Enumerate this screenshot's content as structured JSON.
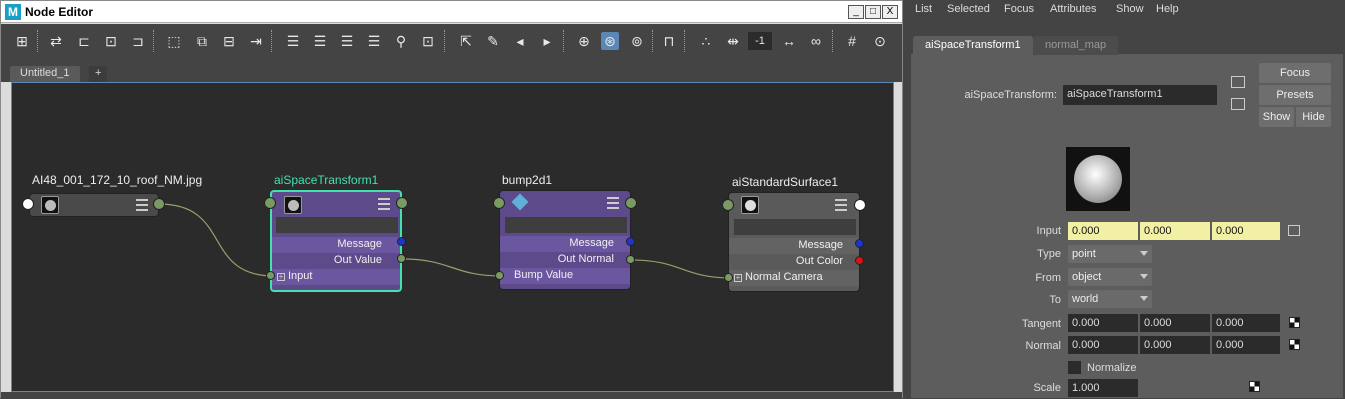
{
  "window": {
    "title": "Node Editor",
    "minimize": "_",
    "maximize": "□",
    "close": "X"
  },
  "toolbar": {
    "icons": [
      "add-node-icon",
      "swap-icon",
      "input-icon",
      "input-output-icon",
      "output-icon",
      "frame-all-icon",
      "frame-selected-icon",
      "graph-up-icon",
      "graph-down-icon",
      "layout-list1-icon",
      "layout-list2-icon",
      "layout-list3-icon",
      "layout-list4-icon",
      "search-icon",
      "snapshot-icon",
      "pin-icon",
      "edit-icon",
      "back-icon",
      "forward-icon",
      "grid-icon",
      "connect-mode-icon",
      "filter-icon",
      "lock-icon",
      "dots-icon",
      "expand-icon",
      "field-icon",
      "swap-horizontal-icon",
      "infinity-icon",
      "hash-icon",
      "magnet-icon"
    ],
    "field_value": "-1"
  },
  "tabs": [
    {
      "label": "Untitled_1"
    },
    {
      "label": "+"
    }
  ],
  "graph": {
    "nodes": {
      "file": {
        "title": "AI48_001_172_10_roof_NM.jpg"
      },
      "space": {
        "title": "aiSpaceTransform1",
        "message": "Message",
        "out": "Out Value",
        "in": "Input"
      },
      "bump": {
        "title": "bump2d1",
        "message": "Message",
        "out": "Out Normal",
        "in": "Bump Value"
      },
      "shader": {
        "title": "aiStandardSurface1",
        "message": "Message",
        "out": "Out Color",
        "in": "Normal Camera"
      }
    },
    "colors": {
      "canvas": "#2b2b2b",
      "file_node": "#4a4a4a",
      "purple_node": "#5c4a8a",
      "shader_node": "#5a5a5a",
      "selected_border": "#43e0b0",
      "wire": "#9a9e6c"
    }
  },
  "attr_editor": {
    "menu": [
      "List",
      "Selected",
      "Focus",
      "Attributes",
      "Show",
      "Help"
    ],
    "tabs": [
      {
        "label": "aiSpaceTransform1",
        "active": true
      },
      {
        "label": "normal_map",
        "active": false
      }
    ],
    "node_label": "aiSpaceTransform:",
    "node_value": "aiSpaceTransform1",
    "buttons": {
      "focus": "Focus",
      "presets": "Presets",
      "show": "Show",
      "hide": "Hide"
    },
    "input": {
      "label": "Input",
      "values": [
        "0.000",
        "0.000",
        "0.000"
      ]
    },
    "type": {
      "label": "Type",
      "value": "point"
    },
    "from": {
      "label": "From",
      "value": "object"
    },
    "to": {
      "label": "To",
      "value": "world"
    },
    "tangent": {
      "label": "Tangent",
      "values": [
        "0.000",
        "0.000",
        "0.000"
      ]
    },
    "normal": {
      "label": "Normal",
      "values": [
        "0.000",
        "0.000",
        "0.000"
      ]
    },
    "normalize": {
      "label": "Normalize",
      "checked": false
    },
    "scale": {
      "label": "Scale",
      "value": "1.000"
    }
  }
}
